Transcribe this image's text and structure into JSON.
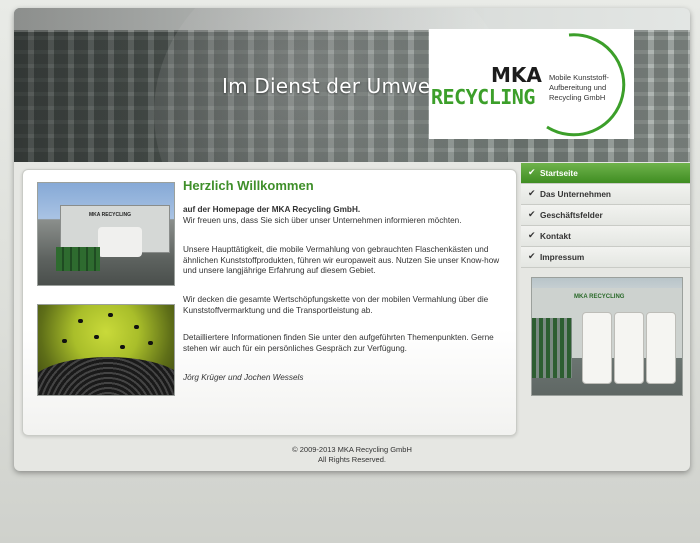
{
  "banner": {
    "slogan": "Im Dienst der Umwelt."
  },
  "logo": {
    "name_line1": "MKA",
    "name_line2": "RECYCLING",
    "tagline": [
      "Mobile Kunststoff-",
      "Aufbereitung und",
      "Recycling GmbH"
    ],
    "colors": {
      "green": "#3c9f2a",
      "dark": "#1c1c1c"
    }
  },
  "nav": {
    "items": [
      {
        "label": "Startseite",
        "active": true
      },
      {
        "label": "Das Unternehmen",
        "active": false
      },
      {
        "label": "Geschäftsfelder",
        "active": false
      },
      {
        "label": "Kontakt",
        "active": false
      },
      {
        "label": "Impressum",
        "active": false
      }
    ],
    "check_icon": "check-icon",
    "active_color": "#4f9f31"
  },
  "content": {
    "title": "Herzlich Willkommen",
    "p_bold": "auf der Homepage der MKA Recycling GmbH.",
    "p_intro": "Wir freuen uns, dass Sie sich über unser Unternehmen informieren möchten.",
    "p_main": "Unsere Haupttätigkeit, die mobile Vermahlung von gebrauchten Flaschenkästen und ähnlichen Kunststoffprodukten, führen wir europaweit aus. Nutzen Sie unser Know-how und unsere langjährige Erfahrung auf diesem Gebiet.",
    "p_chain": "Wir decken die gesamte Wertschöpfungskette von der mobilen Vermahlung über die Kunststoffvermarktung und die Transportleistung ab.",
    "p_info": "Detailliertere Informationen finden Sie unter den aufgeführten Themenpunkten. Gerne stehen wir auch für ein persönliches Gespräch zur Verfügung.",
    "signature": "Jörg Krüger und Jochen Wessels",
    "trailer_label": "MKA RECYCLING"
  },
  "sidebar_image": {
    "label": "MKA RECYCLING"
  },
  "footer": {
    "copyright": "© 2009-2013 MKA Recycling GmbH",
    "rights": "All Rights Reserved."
  }
}
